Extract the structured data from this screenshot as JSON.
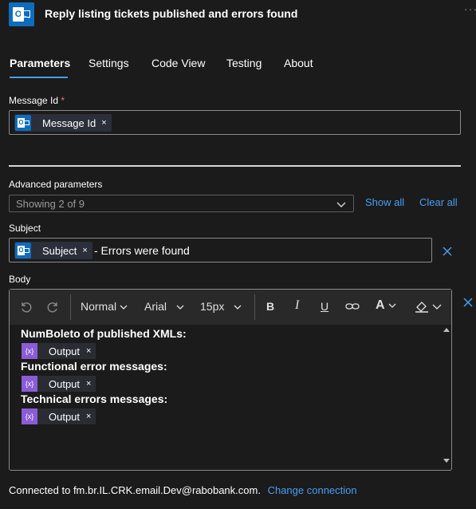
{
  "header": {
    "title": "Reply listing tickets published and errors found",
    "more": "···"
  },
  "tabs": [
    {
      "label": "Parameters",
      "active": true
    },
    {
      "label": "Settings"
    },
    {
      "label": "Code View"
    },
    {
      "label": "Testing"
    },
    {
      "label": "About"
    }
  ],
  "message_id": {
    "label": "Message Id",
    "required_mark": "*",
    "token": "Message Id",
    "token_remove": "×"
  },
  "advanced": {
    "label": "Advanced parameters",
    "selected": "Showing 2 of 9",
    "show_all": "Show all",
    "clear_all": "Clear all"
  },
  "subject": {
    "label": "Subject",
    "token": "Subject",
    "token_remove": "×",
    "suffix": "- Errors were found"
  },
  "body": {
    "label": "Body",
    "toolbar": {
      "block_style": "Normal",
      "font": "Arial",
      "size": "15px"
    },
    "lines": [
      {
        "heading": "NumBoleto of published XMLs:",
        "token_icon": "{x}",
        "token": "Output",
        "remove": "×"
      },
      {
        "heading": "Functional error messages:",
        "token_icon": "{x}",
        "token": "Output",
        "remove": "×"
      },
      {
        "heading": "Technical errors messages:",
        "token_icon": "{x}",
        "token": "Output",
        "remove": "×"
      }
    ]
  },
  "footer": {
    "connected_text": "Connected to fm.br.IL.CRK.email.Dev@rabobank.com.",
    "change_link": "Change connection"
  },
  "colors": {
    "accent": "#479ef5",
    "outlook_blue": "#0f6cbd",
    "variable_purple": "#8a5cd6",
    "required": "#f1707b"
  },
  "icons": [
    "outlook-icon",
    "undo-icon",
    "redo-icon",
    "bold-icon",
    "italic-icon",
    "underline-icon",
    "link-icon",
    "font-color-icon",
    "highlight-icon",
    "close-icon",
    "chevron-down-icon",
    "variable-icon"
  ]
}
